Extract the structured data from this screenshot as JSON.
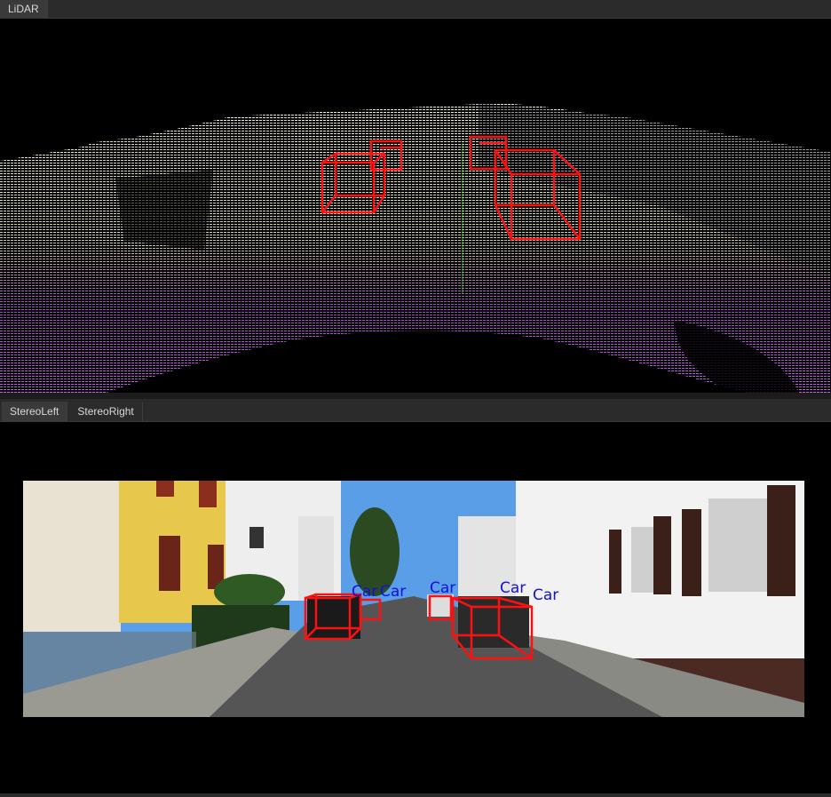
{
  "top_tabs": [
    {
      "label": "LiDAR",
      "active": true
    }
  ],
  "stereo_tabs": [
    {
      "label": "StereoLeft",
      "active": true
    },
    {
      "label": "StereoRight",
      "active": false
    }
  ],
  "detections": [
    {
      "label": "Car"
    },
    {
      "label": "Car"
    },
    {
      "label": "Car"
    },
    {
      "label": "Car"
    },
    {
      "label": "Car"
    }
  ],
  "colors": {
    "tabbar_bg": "#2b2b2b",
    "box_red": "#ff1010",
    "label_blue": "#1010e0",
    "lidar_near": "#c060e0",
    "lidar_far": "#e8e8c8",
    "sky": "#5a9ee8",
    "yellow_house": "#e8c84a",
    "road": "#555555"
  }
}
